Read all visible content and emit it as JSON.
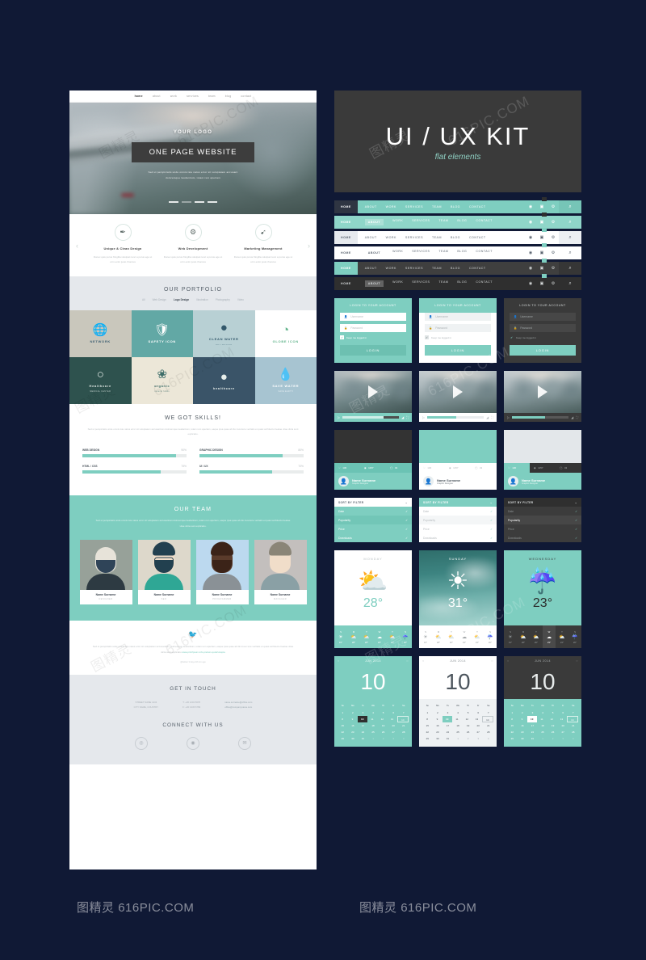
{
  "kit": {
    "title": "UI / UX KIT",
    "subtitle": "flat elements"
  },
  "webpage": {
    "nav": [
      "home",
      "about",
      "work",
      "services",
      "team",
      "blog",
      "contact"
    ],
    "hero": {
      "logo": "YOUR LOGO",
      "button": "ONE PAGE WEBSITE",
      "sub_line1": "Sed ut perspiciatis unde omnis iste natus error sit voluptatem accusant",
      "sub_line2": "doloremque laudantium, totam rem aperiam"
    },
    "services": [
      {
        "icon": "pen-icon",
        "glyph": "✒",
        "title": "Unique & Clean Design",
        "text": "Donec quis purus fringilla volutpat nunc a purus ege ut ut in enim justo rhoncus"
      },
      {
        "icon": "globe-icon",
        "glyph": "⚙",
        "title": "Web Development",
        "text": "Donec quis purus fringilla volutpat nunc a purus ege ut ut in enim justo rhoncus"
      },
      {
        "icon": "rocket-icon",
        "glyph": "➹",
        "title": "Marketing Management",
        "text": "Donec quis purus fringilla volutpat nunc a purus ege ut ut in enim justo rhoncus"
      }
    ],
    "portfolio": {
      "title": "OUR PORTFOLIO",
      "filters": [
        "All",
        "Web Design",
        "Logo Design",
        "Illustration",
        "Photography",
        "Video"
      ],
      "active_filter": "Logo Design",
      "items": [
        {
          "caption": "NETWORK",
          "sub": "",
          "glyph": "🌐",
          "bg": "#c9c7bc",
          "fg": "#3e5f72"
        },
        {
          "caption": "SAFETY ICON",
          "sub": "",
          "glyph": "🛡",
          "bg": "#62a8a5",
          "fg": "#ffffff"
        },
        {
          "caption": "CLEAN WATER",
          "sub": "BOTTLE CLUB",
          "glyph": "●",
          "bg": "#b8d0d4",
          "fg": "#33586b"
        },
        {
          "caption": "GLOBE ICON",
          "sub": "",
          "glyph": "◔",
          "bg": "#ffffff",
          "fg": "#63b48c"
        },
        {
          "caption": "Healthcare",
          "sub": "MEDICAL CENTER",
          "glyph": "○",
          "bg": "#2e524e",
          "fg": "#e7eeea"
        },
        {
          "caption": "organic",
          "sub": "natural foods",
          "glyph": "❀",
          "bg": "#ece7d8",
          "fg": "#3e6e6a"
        },
        {
          "caption": "healthcare",
          "sub": "",
          "glyph": "●",
          "bg": "#3a5468",
          "fg": "#e7eeea"
        },
        {
          "caption": "SAVE WATER",
          "sub": "SAVE EARTH",
          "glyph": "💧",
          "bg": "#a7c4d1",
          "fg": "#ffffff"
        }
      ]
    },
    "skills": {
      "title": "WE GOT SKILLS!",
      "text": "Sed ut perspiciatis unde omnis iste natus error sit voluptatem accusantium doloremque laudantium, totam rem aperiam, eaque ipsa quae ab illo inventore veritatis et quasi architecto beatae vitae dicta sunt explicabo.",
      "items": [
        {
          "label": "WEB DESIGN",
          "value": "90%",
          "pct": 90
        },
        {
          "label": "GRAPHIC DESIGN",
          "value": "80%",
          "pct": 80
        },
        {
          "label": "HTML / CSS",
          "value": "75%",
          "pct": 75
        },
        {
          "label": "UI / UX",
          "value": "70%",
          "pct": 70
        }
      ]
    },
    "team": {
      "title": "OUR TEAM",
      "text": "Sed ut perspiciatis unde omnis iste natus error sit voluptatem accusantium doloremque laudantium, totam rem aperiam, eaque ipsa quae ab illo inventore veritatis et quasi architecto beatae vitae dicta sunt explicabo.",
      "members": [
        {
          "name": "Name Surname",
          "role": "DESIGNER"
        },
        {
          "name": "Name Surname",
          "role": "SEO"
        },
        {
          "name": "Name Surname",
          "role": "PROGRAMMER"
        },
        {
          "name": "Name Surname",
          "role": "MANAGER"
        }
      ]
    },
    "tweet": {
      "icon": "twitter-bird-icon",
      "text": "Sed ut perspiciatis unde omnis iste natus error sit voluptatem accusantium doloremque laudantium, totam rem aperiam, eaque ipsa quae ab illo inven tore veritatis et quasi architecto beatae vitae dicta sunt explicabo",
      "link": "www.printfpsum.info.pretium.quisi/volupta",
      "time": "@twitter 3 days 48 min ago"
    },
    "footer": {
      "title": "GET IN TOUCH",
      "address_line1": "STREET NAME 1234",
      "address_line2": "CITY NAME, COUNTRY",
      "phone_line1": "T: +30 1234 5678",
      "phone_line2": "F: +30 1345 6789",
      "email_line1": "name.surname@office.com",
      "email_line2": "office@companyname.com",
      "connect_title": "CONNECT WITH US",
      "social": [
        "twitter-icon",
        "facebook-icon",
        "mail-icon"
      ]
    }
  },
  "navbars": {
    "home_label": "HOME",
    "links": [
      "ABOUT",
      "WORK",
      "SERVICES",
      "TEAM",
      "BLOG",
      "CONTACT"
    ],
    "tools": [
      "user-icon",
      "mail-icon",
      "gear-icon"
    ],
    "search_icon": "search-icon",
    "variants": [
      {
        "style": "nav-teal",
        "active": "HOME",
        "badge_color": "#2f2f2f"
      },
      {
        "style": "nav-teal2",
        "active": "ABOUT",
        "badge_color": "#2f2f2f"
      },
      {
        "style": "nav-white",
        "active": "HOME",
        "badge_color": "#7ecec0"
      },
      {
        "style": "nav-white2",
        "active": "ABOUT",
        "badge_color": "#7ecec0"
      },
      {
        "style": "nav-dark",
        "active": "HOME",
        "badge_color": "#7ecec0"
      },
      {
        "style": "nav-dark2",
        "active": "ABOUT",
        "badge_color": "#7ecec0"
      }
    ]
  },
  "login": {
    "heading": "LOGIN TO YOUR ACCOUNT",
    "username_placeholder": "Username",
    "password_placeholder": "Password",
    "keep_logged_label": "Keep me logged in",
    "button": "LOGIN",
    "user_icon": "user-icon",
    "lock_icon": "lock-icon",
    "check_glyph": "✔",
    "variants": [
      "lg-a",
      "lg-b",
      "lg-c"
    ]
  },
  "video": {
    "play_icon": "play-icon",
    "small_play_icon": "play-small-icon",
    "volume_icon": "volume-icon",
    "fullscreen_icon": "fullscreen-icon",
    "progress": [
      72,
      52,
      58
    ],
    "variants": [
      "vb-teal",
      "vb-white",
      "vb-dark"
    ]
  },
  "profile": {
    "name": "Name Surname",
    "role": "Graphic Designer",
    "avatar_icon": "avatar-icon",
    "stats": [
      {
        "icon": "heart-icon",
        "glyph": "♡",
        "value": "130"
      },
      {
        "icon": "eye-icon",
        "glyph": "◉",
        "value": "1157"
      },
      {
        "icon": "comment-icon",
        "glyph": "◯",
        "value": "43"
      }
    ],
    "variants": [
      "pf-a",
      "pf-b",
      "pf-c"
    ]
  },
  "sort": {
    "heading": "SORT BY FILTER",
    "chevron": "chevron-down-icon",
    "check_glyph": "✓",
    "items": [
      "Date",
      "Popularity",
      "Price",
      "Downloads"
    ],
    "selected": "Popularity",
    "variants": [
      "sf-a",
      "sf-b",
      "sf-c"
    ]
  },
  "weather": {
    "cards": [
      {
        "day": "MONDAY",
        "temp": "28°",
        "icon": "sun-cloud-icon",
        "glyph": "⛅",
        "style": "wx-a",
        "selected_day": ""
      },
      {
        "day": "SUNDAY",
        "temp": "31°",
        "icon": "sun-icon",
        "glyph": "☀",
        "style": "wx-b",
        "selected_day": "S"
      },
      {
        "day": "WEDNESDAY",
        "temp": "23°",
        "icon": "rain-cloud-icon",
        "glyph": "☔",
        "style": "wx-c",
        "selected_day": "W"
      }
    ],
    "days": [
      "S",
      "M",
      "T",
      "W",
      "T",
      "S"
    ],
    "day_icons": [
      "☀",
      "⛅",
      "⛅",
      "☁",
      "⛅",
      "☔"
    ],
    "temps": [
      "31°",
      "28°",
      "26°",
      "23°",
      "24°",
      "20°"
    ]
  },
  "calendar": {
    "month": "JUN 2014",
    "big_day": "10",
    "prev_icon": "prev-icon",
    "next_icon": "next-icon",
    "weekdays": [
      "Su",
      "Mo",
      "Tu",
      "We",
      "Th",
      "Fr",
      "Sa"
    ],
    "weeks": [
      [
        "1",
        "2",
        "3",
        "4",
        "5",
        "6",
        "7"
      ],
      [
        "8",
        "9",
        "10",
        "11",
        "12",
        "13",
        "14"
      ],
      [
        "15",
        "16",
        "17",
        "18",
        "19",
        "20",
        "21"
      ],
      [
        "22",
        "23",
        "24",
        "25",
        "26",
        "27",
        "28"
      ],
      [
        "29",
        "30",
        "31",
        "1",
        "2",
        "3",
        "4"
      ]
    ],
    "selected": "10",
    "boxed": "14",
    "variants": [
      "cal-a",
      "cal-b",
      "cal-c-t"
    ]
  },
  "watermark": {
    "cn": "图精灵",
    "en": "616PIC.COM"
  },
  "colors": {
    "accent": "#7ecec0",
    "dark": "#3a3a3a",
    "bg": "#101935"
  }
}
